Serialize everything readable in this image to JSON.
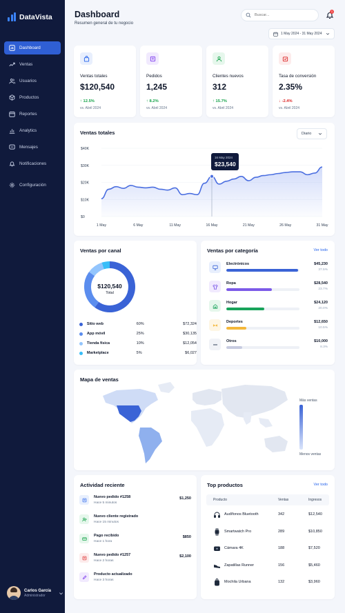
{
  "app": {
    "name": "DataVista"
  },
  "sidebar": {
    "items": [
      {
        "label": "Dashboard",
        "icon": "dashboard-icon",
        "active": true
      },
      {
        "label": "Ventas",
        "icon": "trend-icon"
      },
      {
        "label": "Usuarios",
        "icon": "users-icon"
      },
      {
        "label": "Productos",
        "icon": "box-icon"
      },
      {
        "label": "Reportes",
        "icon": "calendar-icon"
      },
      {
        "label": "Analytics",
        "icon": "bar-chart-icon"
      },
      {
        "label": "Mensajes",
        "icon": "message-icon"
      },
      {
        "label": "Notificaciones",
        "icon": "bell-icon"
      },
      {
        "label": "Configuración",
        "icon": "gear-icon"
      }
    ],
    "user": {
      "name": "Carlos García",
      "role": "Administrador"
    }
  },
  "header": {
    "title": "Dashboard",
    "subtitle": "Resumen general de tu negocio",
    "search_placeholder": "Buscar...",
    "notification_count": "1",
    "date_range": "1 May 2024 - 31 May 2024"
  },
  "kpis": [
    {
      "label": "Ventas totales",
      "value": "$120,540",
      "delta": "↑ 12.5%",
      "compare": "vs. Abril 2024",
      "trend": "up",
      "icon": "bag-icon",
      "color": "#2563eb",
      "bg": "#e8effd"
    },
    {
      "label": "Pedidos",
      "value": "1,245",
      "delta": "↑ 8.2%",
      "compare": "vs. Abril 2024",
      "trend": "up",
      "icon": "cart-icon",
      "color": "#7c3aed",
      "bg": "#f1eafe"
    },
    {
      "label": "Clientes nuevos",
      "value": "312",
      "delta": "↑ 15.7%",
      "compare": "vs. Abril 2024",
      "trend": "up",
      "icon": "user-icon",
      "color": "#16a34a",
      "bg": "#e6f7ec"
    },
    {
      "label": "Tasa de conversión",
      "value": "2.35%",
      "delta": "↓ -2.4%",
      "compare": "vs. Abril 2024",
      "trend": "down",
      "icon": "target-icon",
      "color": "#dc2626",
      "bg": "#fdecec"
    }
  ],
  "sales_chart": {
    "title": "Ventas totales",
    "period": "Diario",
    "tooltip": {
      "date": "16 May 2024",
      "value": "$23,540"
    }
  },
  "chart_data": [
    {
      "type": "area",
      "title": "Ventas totales",
      "x_ticks": [
        "1 May",
        "6 May",
        "11 May",
        "16 May",
        "21 May",
        "26 May",
        "31 May"
      ],
      "y_ticks": [
        "$40K",
        "$30K",
        "$20K",
        "$10K",
        "$0"
      ],
      "ylim": [
        0,
        40000
      ],
      "x": [
        1,
        2,
        3,
        4,
        5,
        6,
        7,
        8,
        9,
        10,
        11,
        12,
        13,
        14,
        15,
        16,
        17,
        18,
        19,
        20,
        21,
        22,
        23,
        24,
        25,
        26,
        27,
        28,
        29,
        30,
        31
      ],
      "values": [
        10500,
        16000,
        17500,
        16500,
        18200,
        17200,
        16800,
        17200,
        16000,
        15500,
        16800,
        12800,
        13500,
        12800,
        19500,
        23540,
        19000,
        20700,
        22000,
        23500,
        21000,
        23000,
        24000,
        24500,
        25200,
        25800,
        26200,
        26200,
        24500,
        25500,
        29000
      ],
      "highlight_index": 15,
      "color": "#4a6ee0"
    },
    {
      "type": "pie",
      "title": "Ventas por canal",
      "labels": [
        "Sitio web",
        "App móvil",
        "Tienda física",
        "Marketplace"
      ],
      "values": [
        60,
        25,
        10,
        5
      ],
      "amounts": [
        "$72,324",
        "$30,135",
        "$12,054",
        "$6,027"
      ],
      "percent_labels": [
        "60%",
        "25%",
        "10%",
        "5%"
      ],
      "colors": [
        "#3a63d6",
        "#5b8dee",
        "#93c5fd",
        "#38bdf8"
      ],
      "total": "$120,540",
      "total_label": "Total"
    },
    {
      "type": "bar",
      "title": "Ventas por categoría",
      "categories": [
        "Electrónicos",
        "Ropa",
        "Hogar",
        "Deportes",
        "Otros"
      ],
      "values": [
        45230,
        28540,
        24120,
        12650,
        10000
      ],
      "amounts": [
        "$45,230",
        "$28,540",
        "$24,120",
        "$12,650",
        "$10,000"
      ],
      "shares": [
        "37.5%",
        "23.7%",
        "20.0%",
        "10.5%",
        "8.3%"
      ],
      "share_fractions": [
        0.98,
        0.62,
        0.52,
        0.27,
        0.22
      ],
      "colors": [
        "#3a63d6",
        "#7c5ae8",
        "#18a35a",
        "#f4b73a",
        "#c7cbe0"
      ],
      "icons": [
        "monitor-icon",
        "shirt-icon",
        "home-icon",
        "dumbbell-icon",
        "more-icon"
      ],
      "icon_bgs": [
        "#e8effd",
        "#f1eafe",
        "#e6f7ec",
        "#fef6e4",
        "#f1f3f7"
      ]
    }
  ],
  "channels": {
    "title": "Ventas por canal"
  },
  "categories": {
    "title": "Ventas por categoría",
    "see_all": "Ver todo"
  },
  "map": {
    "title": "Mapa de ventas",
    "legend_high": "Más ventas",
    "legend_low": "Menos ventas"
  },
  "activity": {
    "title": "Actividad reciente",
    "items": [
      {
        "title": "Nuevo pedido #1258",
        "time": "Hace 5 minutos",
        "amount": "$1,250",
        "icon": "cart-icon",
        "color": "#2563eb",
        "bg": "#e8effd"
      },
      {
        "title": "Nuevo cliente registrado",
        "time": "Hace 15 minutos",
        "amount": "",
        "icon": "user-plus-icon",
        "color": "#16a34a",
        "bg": "#e6f7ec"
      },
      {
        "title": "Pago recibido",
        "time": "Hace 1 hora",
        "amount": "$850",
        "icon": "payment-icon",
        "color": "#16a34a",
        "bg": "#e6f7ec"
      },
      {
        "title": "Nuevo pedido #1257",
        "time": "Hace 2 horas",
        "amount": "$2,100",
        "icon": "cart-icon",
        "color": "#dc2626",
        "bg": "#fdecec"
      },
      {
        "title": "Producto actualizado",
        "time": "Hace 3 horas",
        "amount": "",
        "icon": "edit-icon",
        "color": "#7c3aed",
        "bg": "#f1eafe"
      }
    ]
  },
  "top_products": {
    "title": "Top productos",
    "see_all": "Ver todo",
    "columns": [
      "Producto",
      "Ventas",
      "Ingresos"
    ],
    "rows": [
      {
        "name": "Audífonos Bluetooth",
        "units": "342",
        "revenue": "$12,540",
        "icon": "headphones-icon"
      },
      {
        "name": "Smartwatch Pro",
        "units": "289",
        "revenue": "$10,850",
        "icon": "watch-icon"
      },
      {
        "name": "Cámara 4K",
        "units": "188",
        "revenue": "$7,520",
        "icon": "camera-icon"
      },
      {
        "name": "Zapatillas Runner",
        "units": "156",
        "revenue": "$5,460",
        "icon": "shoe-icon"
      },
      {
        "name": "Mochila Urbana",
        "units": "132",
        "revenue": "$3,960",
        "icon": "backpack-icon"
      }
    ]
  }
}
